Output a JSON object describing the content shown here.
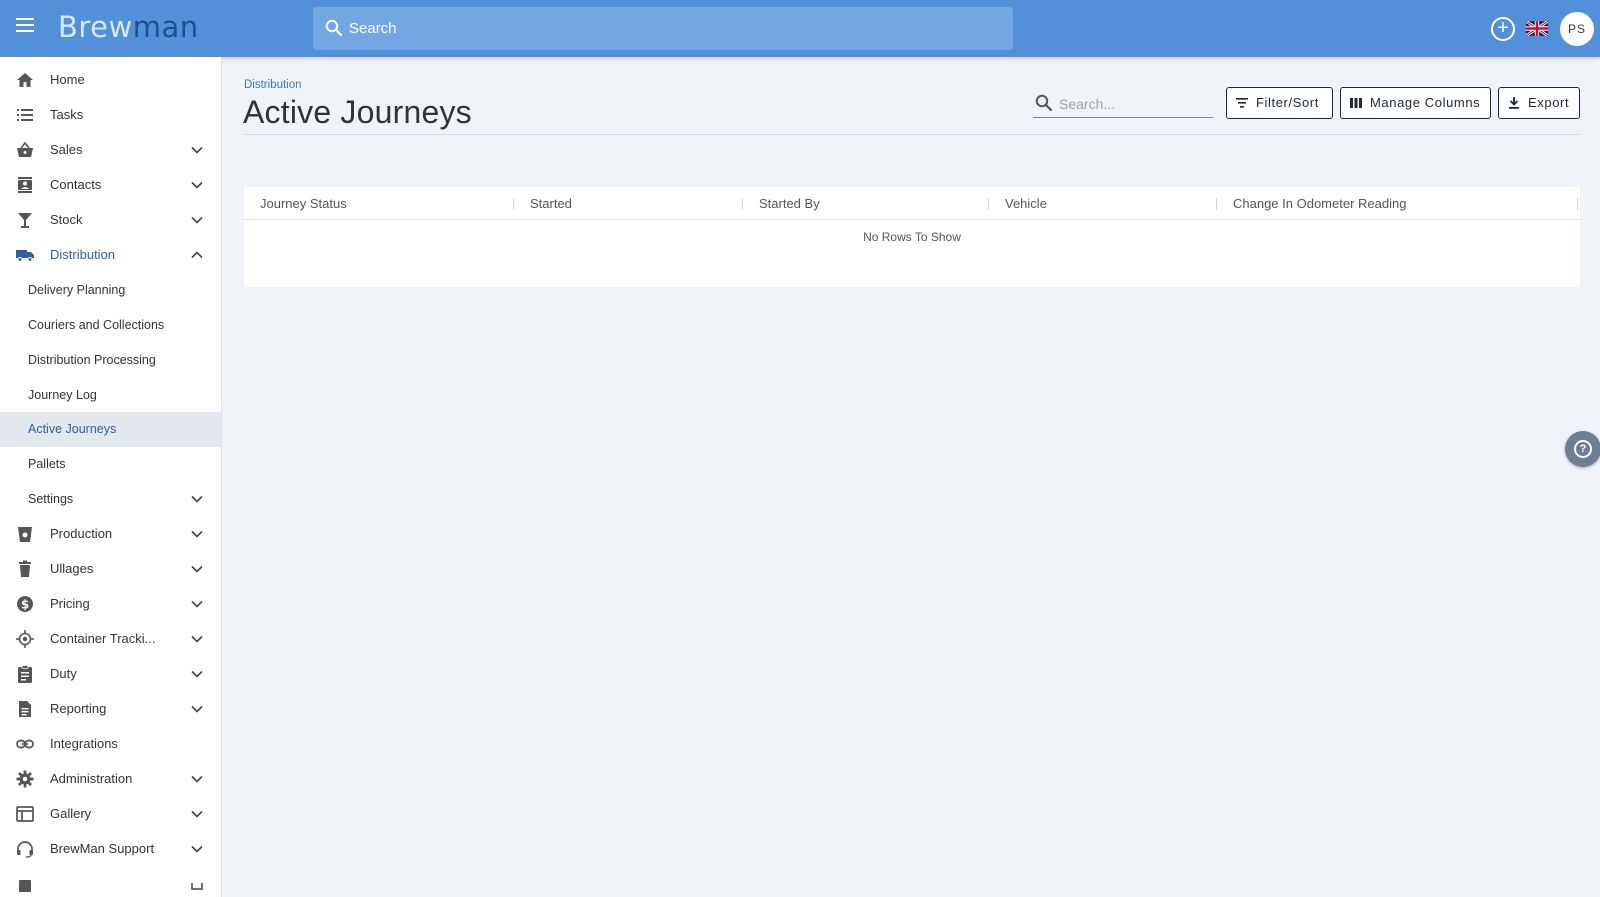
{
  "app": {
    "logo_part1": "Brew",
    "logo_part2": "man",
    "search_placeholder": "Search",
    "add_label": "+",
    "avatar_initials": "PS"
  },
  "sidebar": {
    "items": [
      {
        "label": "Home",
        "icon": "home-icon"
      },
      {
        "label": "Tasks",
        "icon": "list-icon"
      },
      {
        "label": "Sales",
        "icon": "basket-icon"
      },
      {
        "label": "Contacts",
        "icon": "contacts-icon"
      },
      {
        "label": "Stock",
        "icon": "glass-icon"
      },
      {
        "label": "Distribution",
        "icon": "truck-icon"
      }
    ],
    "distribution_sub": [
      {
        "label": "Delivery Planning"
      },
      {
        "label": "Couriers and Collections"
      },
      {
        "label": "Distribution Processing"
      },
      {
        "label": "Journey Log"
      },
      {
        "label": "Active Journeys"
      },
      {
        "label": "Pallets"
      },
      {
        "label": "Settings"
      }
    ],
    "items_after": [
      {
        "label": "Production",
        "icon": "production-icon"
      },
      {
        "label": "Ullages",
        "icon": "trash-icon"
      },
      {
        "label": "Pricing",
        "icon": "dollar-icon"
      },
      {
        "label": "Container Tracki...",
        "icon": "target-icon"
      },
      {
        "label": "Duty",
        "icon": "clipboard-icon"
      },
      {
        "label": "Reporting",
        "icon": "document-icon"
      },
      {
        "label": "Integrations",
        "icon": "link-icon"
      },
      {
        "label": "Administration",
        "icon": "gear-icon"
      },
      {
        "label": "Gallery",
        "icon": "gallery-icon"
      },
      {
        "label": "BrewMan Support",
        "icon": "headset-icon"
      }
    ]
  },
  "main": {
    "breadcrumb": "Distribution",
    "title": "Active Journeys",
    "search_placeholder": "Search...",
    "buttons": {
      "filter": "Filter/Sort",
      "columns": "Manage Columns",
      "export": "Export"
    },
    "grid": {
      "columns": [
        "Journey Status",
        "Started",
        "Started By",
        "Vehicle",
        "Change In Odometer Reading"
      ],
      "empty_text": "No Rows To Show"
    }
  },
  "colors": {
    "topbar": "#5291d9",
    "accent": "#2f5fa0",
    "selected_bg": "#e3e8ef"
  }
}
